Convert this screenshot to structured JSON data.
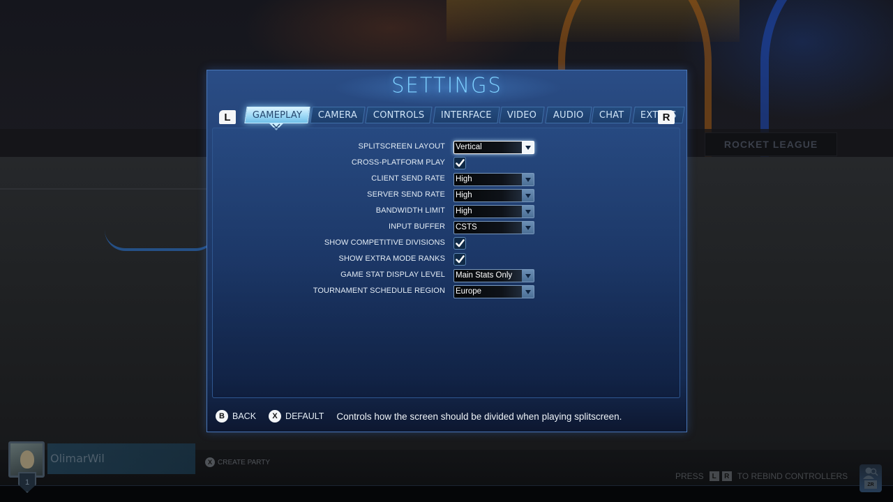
{
  "title": "SETTINGS",
  "bumpers": {
    "left": "L",
    "right": "R"
  },
  "tabs": [
    {
      "label": "GAMEPLAY",
      "active": true
    },
    {
      "label": "CAMERA",
      "active": false
    },
    {
      "label": "CONTROLS",
      "active": false
    },
    {
      "label": "INTERFACE",
      "active": false
    },
    {
      "label": "VIDEO",
      "active": false
    },
    {
      "label": "AUDIO",
      "active": false
    },
    {
      "label": "CHAT",
      "active": false
    },
    {
      "label": "EXTRAS",
      "active": false
    }
  ],
  "settings": [
    {
      "label": "SPLITSCREEN LAYOUT",
      "type": "dropdown",
      "value": "Vertical",
      "focused": true
    },
    {
      "label": "CROSS-PLATFORM PLAY",
      "type": "checkbox",
      "checked": true
    },
    {
      "label": "CLIENT SEND RATE",
      "type": "dropdown",
      "value": "High"
    },
    {
      "label": "SERVER SEND RATE",
      "type": "dropdown",
      "value": "High"
    },
    {
      "label": "BANDWIDTH LIMIT",
      "type": "dropdown",
      "value": "High"
    },
    {
      "label": "INPUT BUFFER",
      "type": "dropdown",
      "value": "CSTS"
    },
    {
      "label": "SHOW COMPETITIVE DIVISIONS",
      "type": "checkbox",
      "checked": true
    },
    {
      "label": "SHOW EXTRA MODE RANKS",
      "type": "checkbox",
      "checked": true
    },
    {
      "label": "GAME STAT DISPLAY LEVEL",
      "type": "dropdown",
      "value": "Main Stats Only"
    },
    {
      "label": "TOURNAMENT SCHEDULE REGION",
      "type": "dropdown",
      "value": "Europe"
    }
  ],
  "footer": {
    "back": {
      "glyph": "B",
      "label": "BACK"
    },
    "default": {
      "glyph": "X",
      "label": "DEFAULT"
    },
    "description": "Controls how the screen should be divided when playing splitscreen."
  },
  "player": {
    "name": "OlimarWil",
    "rank": "1"
  },
  "create_party": {
    "glyph": "X",
    "label": "CREATE PARTY"
  },
  "rebind": {
    "prefix": "PRESS",
    "key1": "L",
    "key2": "R",
    "suffix": "TO REBIND CONTROLLERS"
  },
  "friends": {
    "key": "ZR"
  },
  "background": {
    "banner_text": "ROCKET LEAGUE"
  },
  "colors": {
    "accent": "#7ed0ff",
    "panel": "#244275",
    "tab_active": "#9ed8f6"
  }
}
